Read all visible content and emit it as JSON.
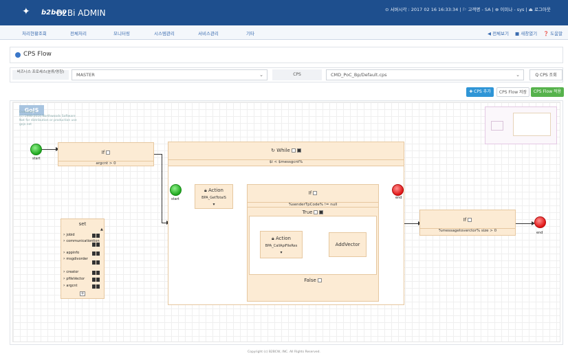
{
  "header": {
    "logo_text": "b2bcw",
    "app_title": "B2Bi ADMIN",
    "status_line": "⊙ 서버시각 : 2017 02 16 16:33:34 | ⚐ 고객명 - SA | ⊗ 이미나 - sys | ⏏ 로그아웃"
  },
  "nav": {
    "items": [
      "처리현황조회",
      "전체처리",
      "모니터링",
      "시스템관리",
      "서비스관리",
      "기타"
    ],
    "right": [
      "◀ 전체보기",
      "■ 새창열기",
      "❓ 도움말"
    ]
  },
  "page": {
    "title": "CPS Flow"
  },
  "filters": {
    "bp_label": "비즈니스 프로세스(분류/명칭)",
    "bp_value": "MASTER",
    "cps_label": "CPS",
    "cps_value": "CMD_PoC_Bp/Default.cps",
    "search_label": "Q CPS 조회"
  },
  "actions": {
    "add": "✚ CPS 추가",
    "save": "CPS Flow 저장",
    "apply": "CPS Flow 적용"
  },
  "watermark": {
    "logo": "GoJS",
    "lines": [
      "Evaluation",
      "(c) 1998-2016 Northwoods Software",
      "Not for distribution or production use",
      "gojs.net"
    ]
  },
  "flow": {
    "start1": "start",
    "if1": {
      "title": "If",
      "cond": "argcnt > 0"
    },
    "while": {
      "title": "While",
      "cond": "$i < $messgcnt%"
    },
    "start2": "start",
    "action1": {
      "title": "Action",
      "sub": "BPA_GetTotalS"
    },
    "if2": {
      "title": "If",
      "cond": "%senderTpCode% != null"
    },
    "true_label": "True",
    "false_label": "False",
    "action2": {
      "title": "Action",
      "sub": "BPA_CallApiFileRes"
    },
    "add_vector": "AddVector",
    "end_inner": "end",
    "if3": {
      "title": "If",
      "cond": "%messagetoverctor% size > 0"
    },
    "end_outer": "end",
    "set": {
      "title": "set",
      "rows": [
        "jobid",
        "communicationtion",
        "appinfo",
        "msgdivorder",
        "creator",
        "pfileVector",
        "argcnt"
      ]
    }
  },
  "footer": "Copyright (c) B2BCW, INC. All Rights Reserved."
}
